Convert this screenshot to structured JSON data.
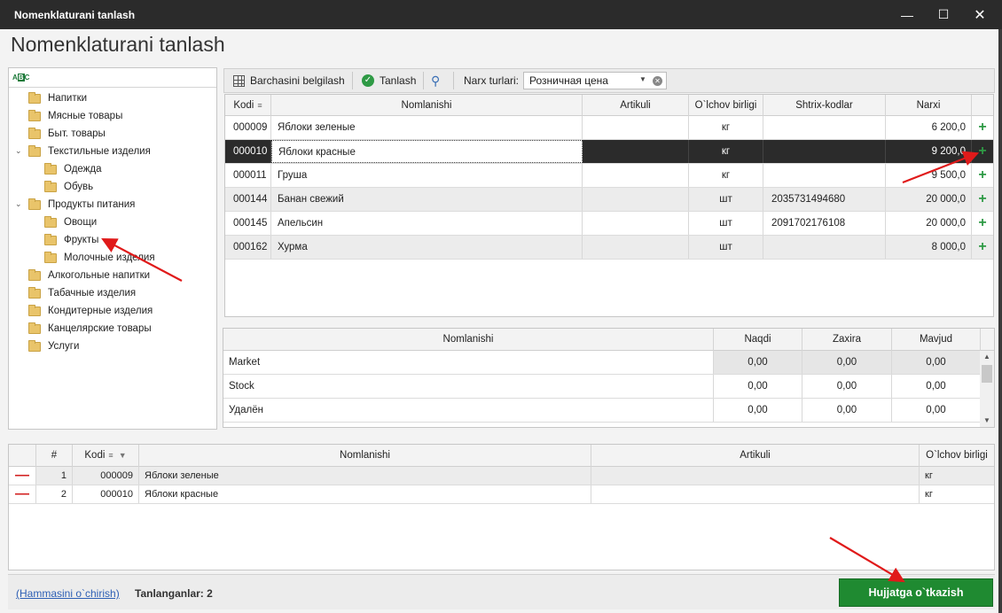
{
  "window": {
    "title": "Nomenklaturani tanlash",
    "heading": "Nomenklaturani tanlash",
    "minimize": "—",
    "maximize": "☐",
    "close": "✕"
  },
  "tree": {
    "search_icon_text": "A B C",
    "items": [
      {
        "label": "Напитки"
      },
      {
        "label": "Мясные товары"
      },
      {
        "label": "Быт. товары"
      },
      {
        "label": "Текстильные изделия"
      },
      {
        "label": "Одежда"
      },
      {
        "label": "Обувь"
      },
      {
        "label": "Продукты питания"
      },
      {
        "label": "Овощи"
      },
      {
        "label": "Фрукты"
      },
      {
        "label": "Молочные изделия"
      },
      {
        "label": "Алкогольные напитки"
      },
      {
        "label": "Табачные изделия"
      },
      {
        "label": "Кондитерные изделия"
      },
      {
        "label": "Канцелярские товары"
      },
      {
        "label": "Услуги"
      }
    ]
  },
  "toolbar": {
    "select_all_label": "Barchasini belgilash",
    "choose_label": "Tanlash",
    "price_types_label": "Narx turlari:",
    "price_type_value": "Розничная цена"
  },
  "products": {
    "columns": [
      "Kodi",
      "Nomlanishi",
      "Artikuli",
      "O`lchov birligi",
      "Shtrix-kodlar",
      "Narxi"
    ],
    "rows": [
      {
        "code": "000009",
        "name": "Яблоки зеленые",
        "article": "",
        "unit": "кг",
        "barcode": "",
        "price": "6 200,0"
      },
      {
        "code": "000010",
        "name": "Яблоки красные",
        "article": "",
        "unit": "кг",
        "barcode": "",
        "price": "9 200,0"
      },
      {
        "code": "000011",
        "name": "Груша",
        "article": "",
        "unit": "кг",
        "barcode": "",
        "price": "9 500,0"
      },
      {
        "code": "000144",
        "name": "Банан свежий",
        "article": "",
        "unit": "шт",
        "barcode": "2035731494680",
        "price": "20 000,0"
      },
      {
        "code": "000145",
        "name": "Апельсин",
        "article": "",
        "unit": "шт",
        "barcode": "2091702176108",
        "price": "20 000,0"
      },
      {
        "code": "000162",
        "name": "Хурма",
        "article": "",
        "unit": "шт",
        "barcode": "",
        "price": "8 000,0"
      }
    ],
    "add_symbol": "+"
  },
  "stock": {
    "columns": [
      "Nomlanishi",
      "Naqdi",
      "Zaxira",
      "Mavjud"
    ],
    "rows": [
      {
        "name": "Market",
        "naqdi": "0,00",
        "zaxira": "0,00",
        "mavjud": "0,00"
      },
      {
        "name": "Stock",
        "naqdi": "0,00",
        "zaxira": "0,00",
        "mavjud": "0,00"
      },
      {
        "name": "Удалён",
        "naqdi": "0,00",
        "zaxira": "0,00",
        "mavjud": "0,00"
      }
    ]
  },
  "selected": {
    "columns": [
      "#",
      "Kodi",
      "Nomlanishi",
      "Artikuli",
      "O`lchov birligi"
    ],
    "rows": [
      {
        "num": "1",
        "code": "000009",
        "name": "Яблоки зеленые",
        "article": "",
        "unit": "кг"
      },
      {
        "num": "2",
        "code": "000010",
        "name": "Яблоки красные",
        "article": "",
        "unit": "кг"
      }
    ],
    "remove_symbol": "—"
  },
  "footer": {
    "delete_all_link": "(Hammasini o`chirish)",
    "selected_count": "Tanlanganlar: 2",
    "transfer_button": "Hujjatga o`tkazish"
  },
  "colors": {
    "accent_green": "#1f8a31",
    "selection_dark": "#2b2b2b",
    "annotation_red": "#e01a1a"
  }
}
